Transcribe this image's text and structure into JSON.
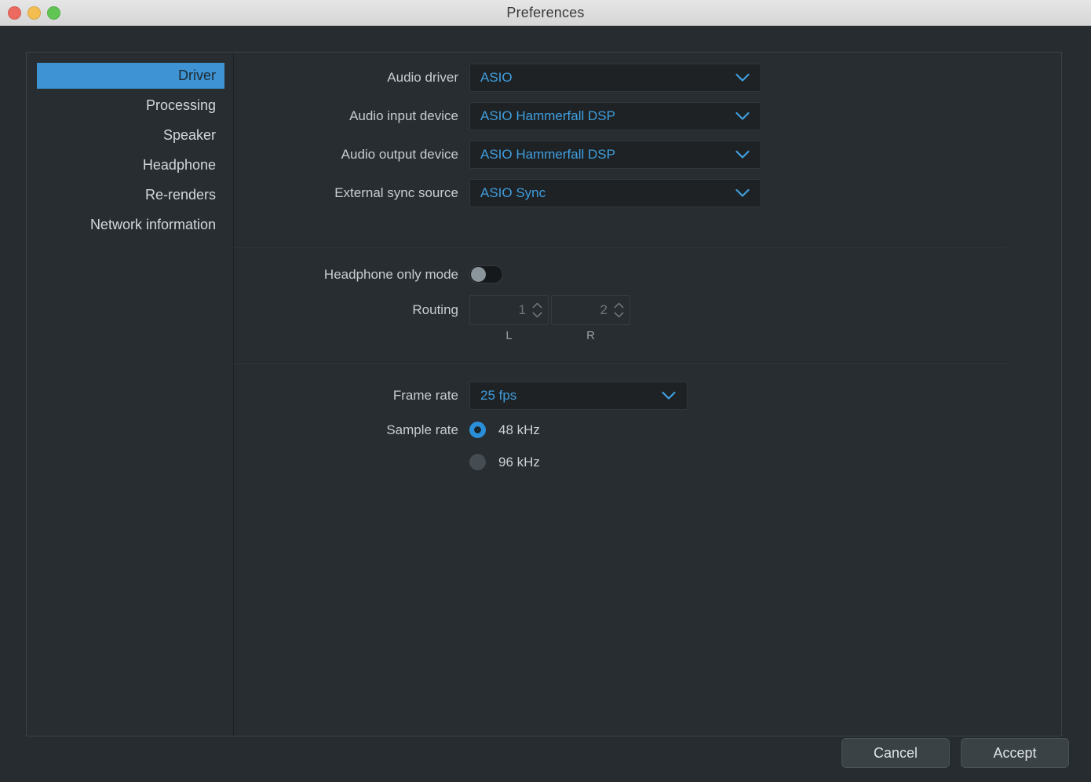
{
  "titlebar": {
    "title": "Preferences",
    "traffic_lights": [
      {
        "name": "close",
        "color": "#ec6a5f"
      },
      {
        "name": "minimize",
        "color": "#f4bd50"
      },
      {
        "name": "zoom",
        "color": "#61c554"
      }
    ]
  },
  "sidebar": {
    "items": [
      {
        "label": "Driver",
        "selected": true
      },
      {
        "label": "Processing",
        "selected": false
      },
      {
        "label": "Speaker",
        "selected": false
      },
      {
        "label": "Headphone",
        "selected": false
      },
      {
        "label": "Re-renders",
        "selected": false
      },
      {
        "label": "Network information",
        "selected": false
      }
    ]
  },
  "driver": {
    "audio_driver": {
      "label": "Audio driver",
      "value": "ASIO"
    },
    "audio_input_device": {
      "label": "Audio input device",
      "value": "ASIO Hammerfall DSP"
    },
    "audio_output_device": {
      "label": "Audio output device",
      "value": "ASIO Hammerfall DSP"
    },
    "external_sync_source": {
      "label": "External sync source",
      "value": "ASIO Sync"
    },
    "headphone_only_mode": {
      "label": "Headphone only mode",
      "state": "off"
    },
    "routing": {
      "label": "Routing",
      "left": {
        "value": "1",
        "caption": "L"
      },
      "right": {
        "value": "2",
        "caption": "R"
      }
    },
    "frame_rate": {
      "label": "Frame rate",
      "value": "25 fps"
    },
    "sample_rate": {
      "label": "Sample rate",
      "options": [
        {
          "label": "48 kHz",
          "selected": true
        },
        {
          "label": "96 kHz",
          "selected": false
        }
      ]
    }
  },
  "footer": {
    "cancel_label": "Cancel",
    "accept_label": "Accept"
  },
  "icons": {
    "chevron_down": "chevron-down-icon",
    "spinner_up": "chevron-up-icon",
    "spinner_down": "chevron-down-icon"
  },
  "colors": {
    "accent_blue": "#3d93d4",
    "value_blue": "#3f9ede",
    "panel_bg": "#272d31",
    "window_bg": "#262c2f",
    "field_bg": "#1e2225"
  }
}
